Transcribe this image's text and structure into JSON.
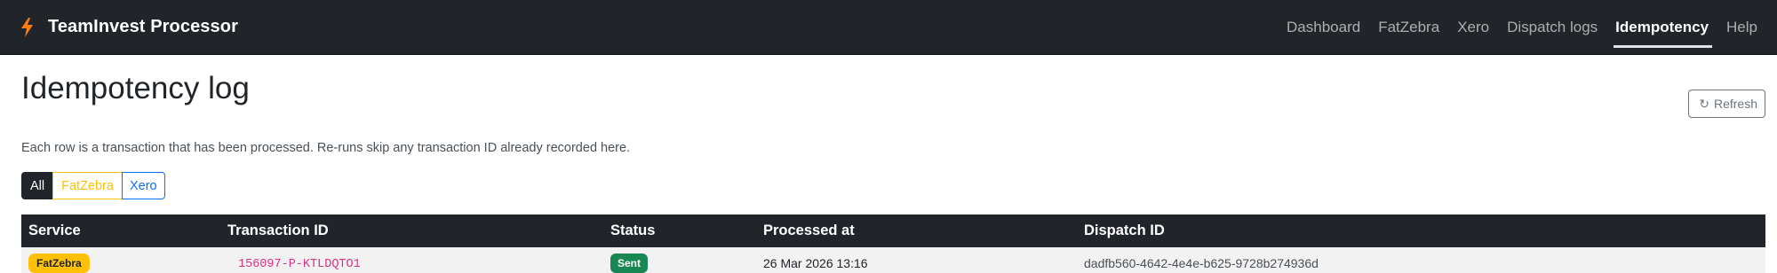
{
  "navbar": {
    "brand": "TeamInvest Processor",
    "brand_icon": "bolt-icon",
    "brand_icon_color": "#fd7e14",
    "links": [
      {
        "label": "Dashboard"
      },
      {
        "label": "FatZebra"
      },
      {
        "label": "Xero"
      },
      {
        "label": "Dispatch logs"
      },
      {
        "label": "Idempotency",
        "active": true
      },
      {
        "label": "Help"
      }
    ]
  },
  "page": {
    "title": "Idempotency log",
    "refresh_label": "Refresh",
    "refresh_icon": "refresh-icon",
    "description": "Each row is a transaction that has been processed. Re-runs skip any transaction ID already recorded here."
  },
  "filters": {
    "all": "All",
    "fatzebra": "FatZebra",
    "xero": "Xero",
    "active": "All"
  },
  "table": {
    "headers": [
      "Service",
      "Transaction ID",
      "Status",
      "Processed at",
      "Dispatch ID"
    ],
    "rows": [
      {
        "service": "FatZebra",
        "transaction_id": "156097-P-KTLDQTO1",
        "status": "Sent",
        "processed_at": "26 Mar 2026 13:16",
        "dispatch_id": "dadfb560-4642-4e4e-b625-9728b274936d"
      }
    ]
  },
  "colors": {
    "navbar_bg": "#212529",
    "fatzebra": "#ffc107",
    "xero": "#0d6efd",
    "sent": "#198754"
  }
}
